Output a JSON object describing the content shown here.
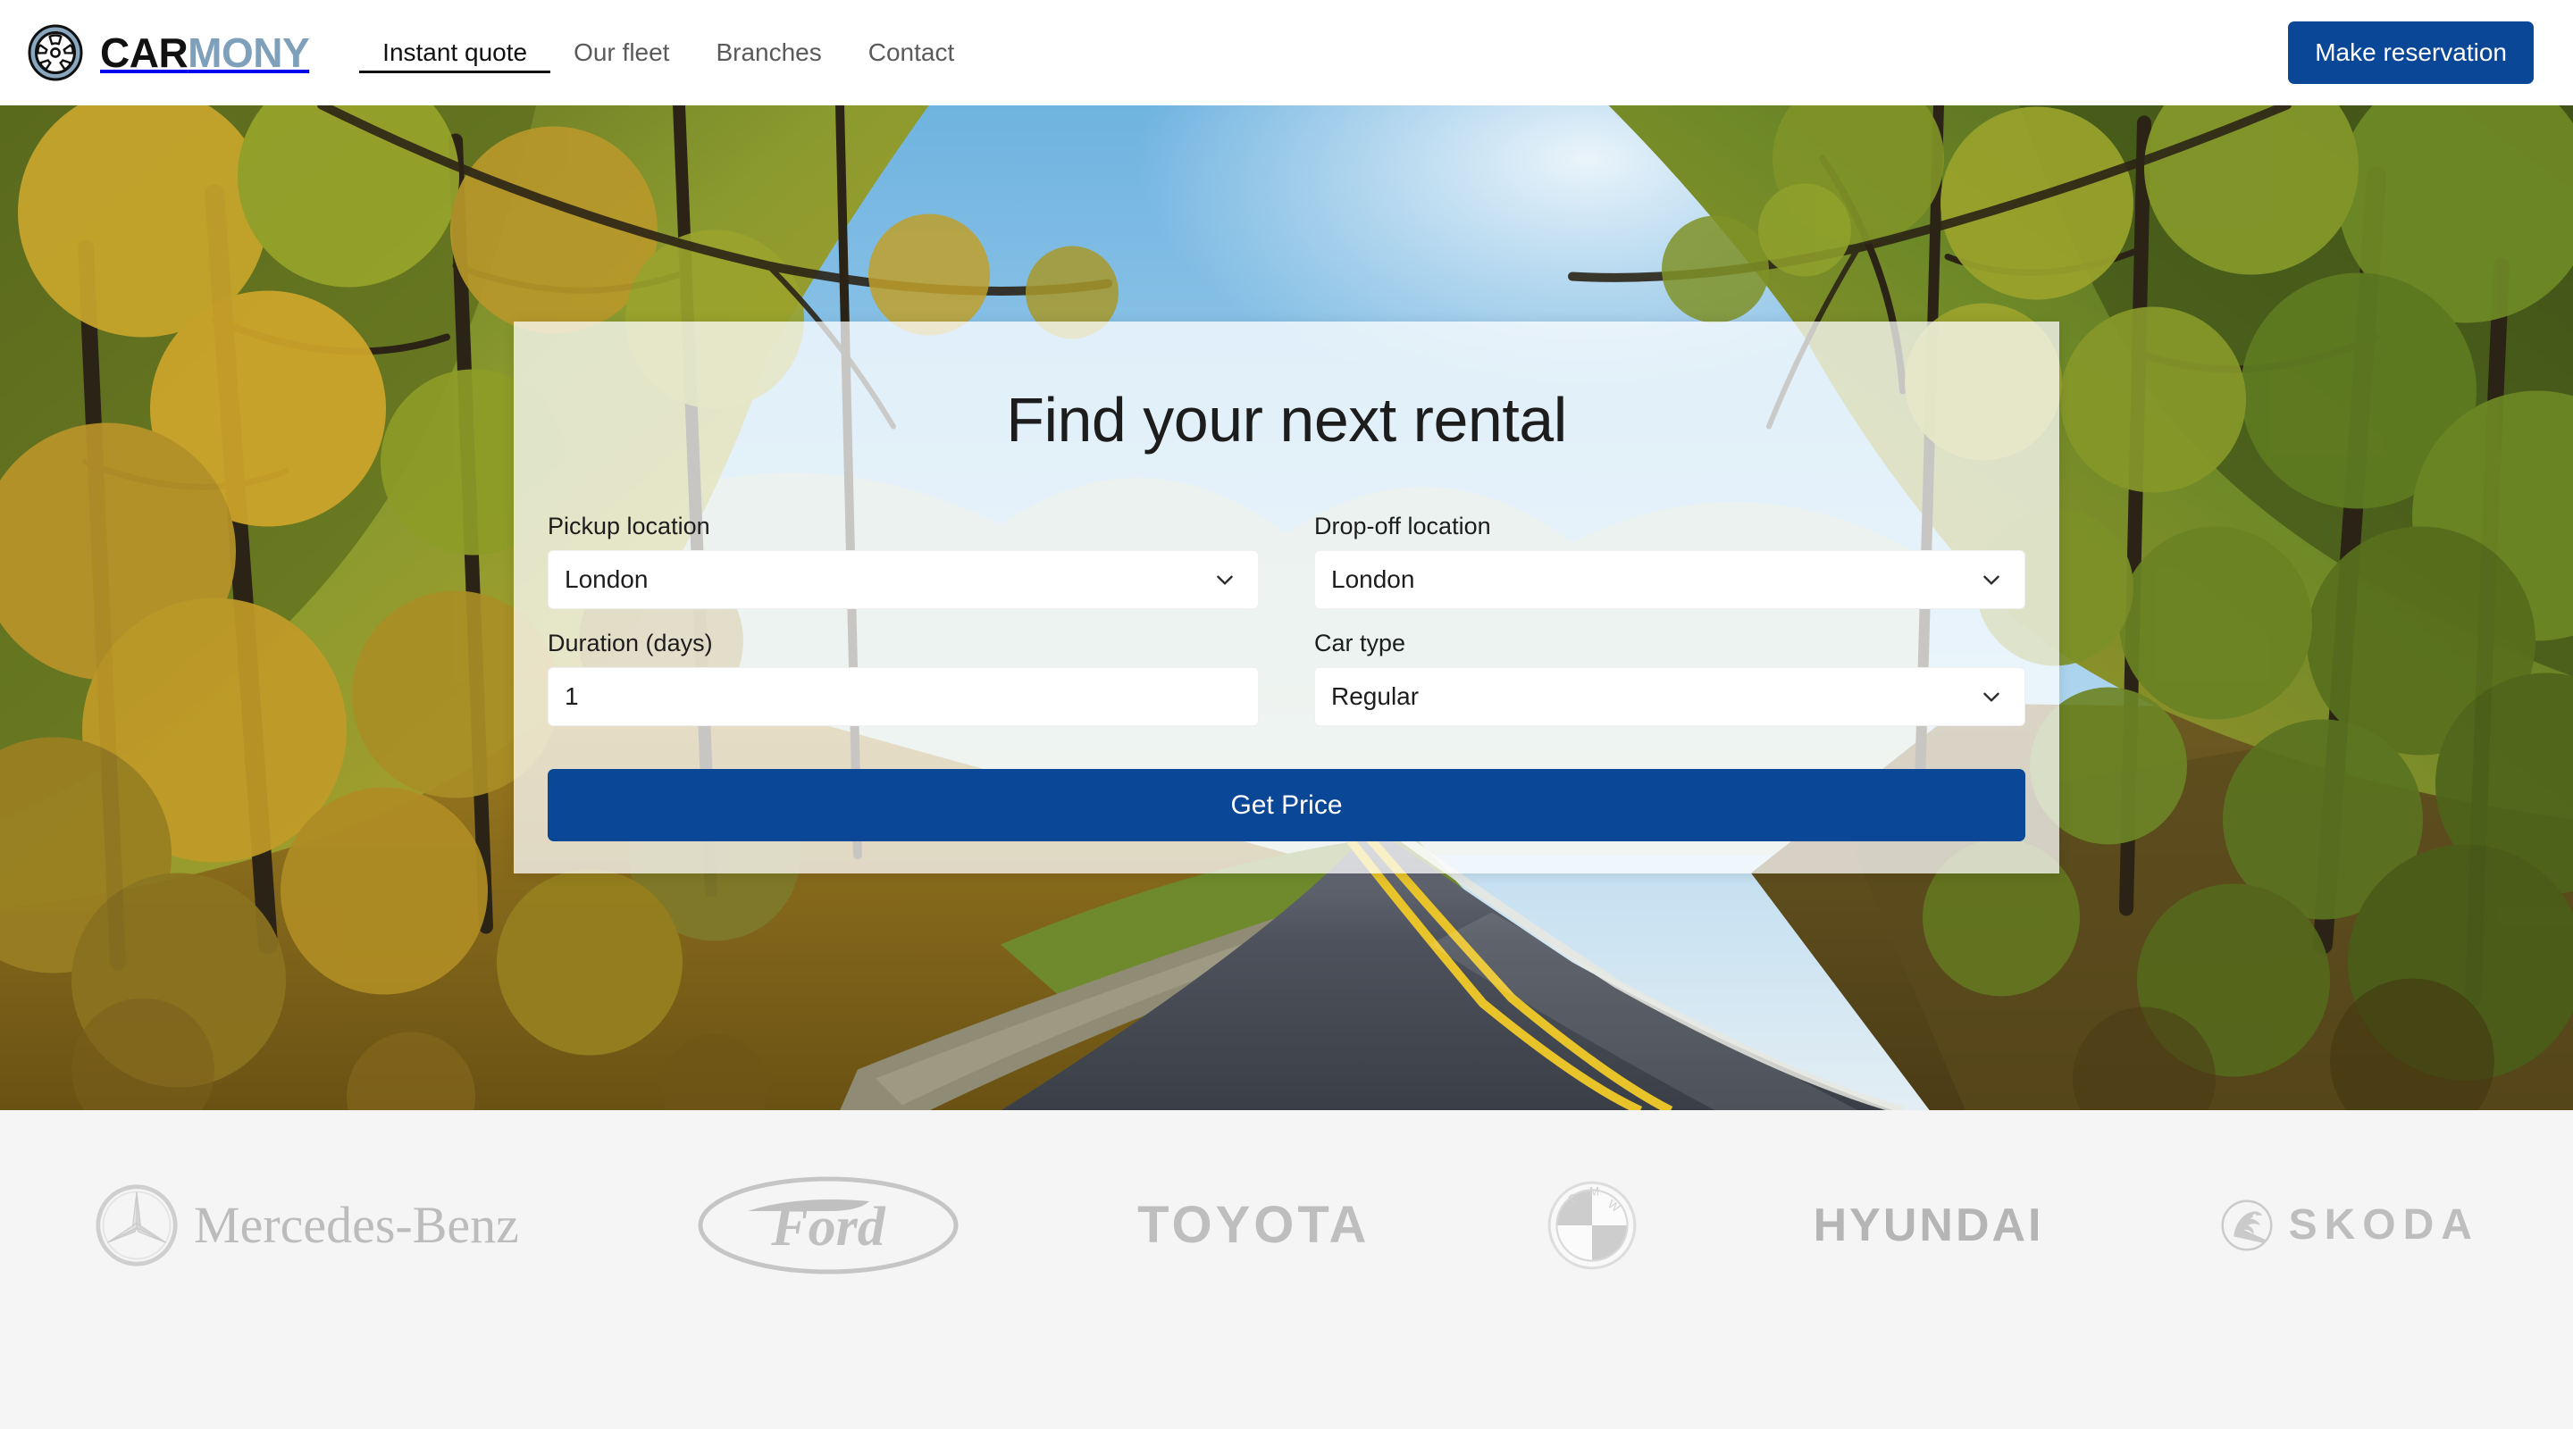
{
  "header": {
    "logo": {
      "icon": "wheel-icon",
      "text_primary": "CAR",
      "text_secondary": "MONY"
    },
    "nav": [
      {
        "label": "Instant quote",
        "active": true
      },
      {
        "label": "Our fleet",
        "active": false
      },
      {
        "label": "Branches",
        "active": false
      },
      {
        "label": "Contact",
        "active": false
      }
    ],
    "reserve_label": "Make reservation",
    "accent_color": "#0b4797"
  },
  "hero": {
    "image_description": "Winding two-lane road through autumn forest with yellow centerline",
    "card": {
      "title": "Find your next rental",
      "fields": [
        {
          "label": "Pickup location",
          "value": "London",
          "type": "select",
          "icon": "chevron-down-icon"
        },
        {
          "label": "Drop-off location",
          "value": "London",
          "type": "select",
          "icon": "chevron-down-icon"
        },
        {
          "label": "Duration (days)",
          "value": "1",
          "type": "number",
          "icon": null
        },
        {
          "label": "Car type",
          "value": "Regular",
          "type": "select",
          "icon": "chevron-down-icon"
        }
      ],
      "submit_label": "Get Price"
    }
  },
  "brands": [
    {
      "name": "Mercedes-Benz",
      "icon": "mercedes-star-icon",
      "wordmark": "Mercedes-Benz"
    },
    {
      "name": "Ford",
      "icon": "ford-oval-icon",
      "wordmark": ""
    },
    {
      "name": "Toyota",
      "icon": null,
      "wordmark": "TOYOTA"
    },
    {
      "name": "BMW",
      "icon": "bmw-roundel-icon",
      "wordmark": ""
    },
    {
      "name": "Hyundai",
      "icon": null,
      "wordmark": "HYUNDAI"
    },
    {
      "name": "Skoda",
      "icon": "skoda-wing-icon",
      "wordmark": "SKODA"
    }
  ]
}
